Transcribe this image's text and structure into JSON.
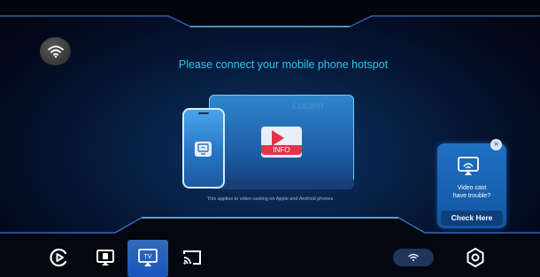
{
  "main": {
    "title": "Please connect your mobile phone hotspot",
    "note": "This applies to video casting on Apple and Android phones",
    "illustration": {
      "card_label": "INFO",
      "watermark": "Lucien"
    }
  },
  "help_card": {
    "text": "Video cast\nhave trouble?",
    "button_label": "Check Here",
    "close_glyph": "×"
  },
  "bottom_nav": {
    "active_tab": "tv-cast",
    "tv_label": "TV",
    "items": [
      "play-icon",
      "screen-mirror-icon",
      "tv-cast-icon",
      "cast-icon",
      "wifi-icon",
      "settings-icon"
    ]
  },
  "colors": {
    "accent": "#27c6f0",
    "card_bg": "#1f6fc2",
    "active_nav": "#3a86f0",
    "alert": "#e5324b"
  }
}
